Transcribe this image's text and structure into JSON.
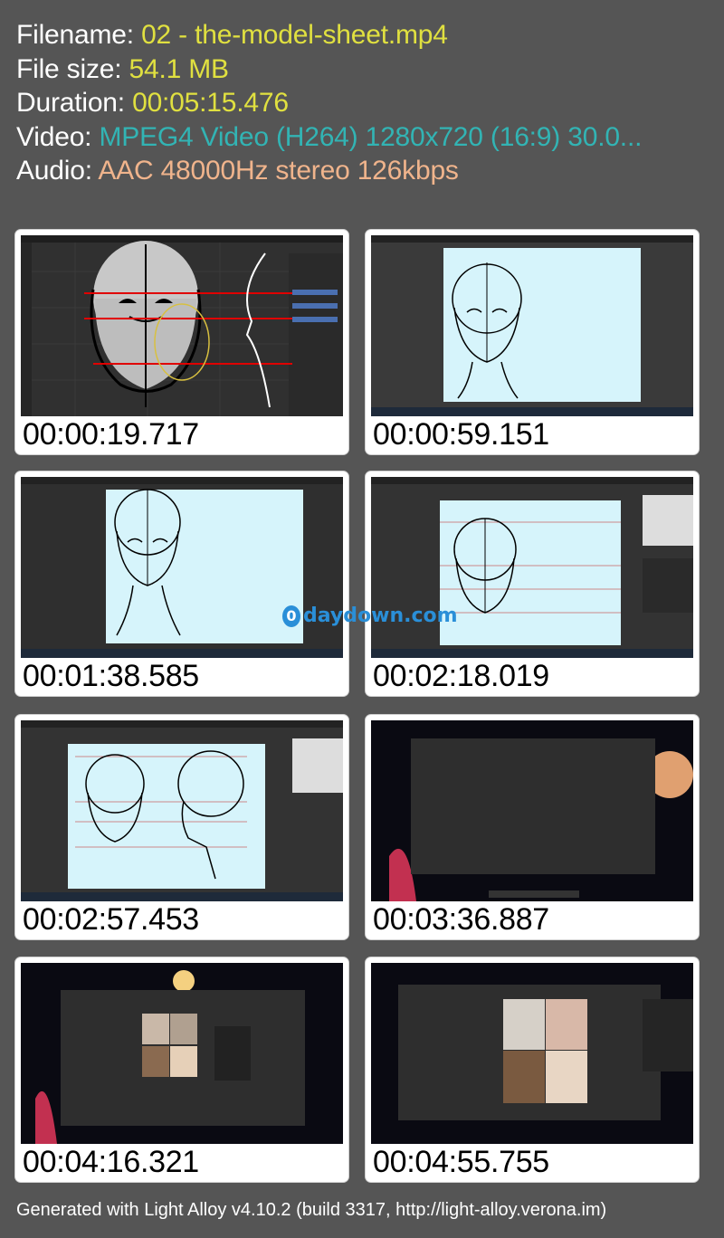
{
  "info": {
    "filename_label": "Filename: ",
    "filename_value": "02 - the-model-sheet.mp4",
    "filesize_label": "File size: ",
    "filesize_value": "54.1 MB",
    "duration_label": "Duration: ",
    "duration_value": "00:05:15.476",
    "video_label": "Video: ",
    "video_value": "MPEG4 Video (H264) 1280x720 (16:9) 30.0...",
    "audio_label": "Audio: ",
    "audio_value": "AAC 48000Hz stereo 126kbps"
  },
  "thumbnails": [
    {
      "timestamp": "00:00:19.717"
    },
    {
      "timestamp": "00:00:59.151"
    },
    {
      "timestamp": "00:01:38.585"
    },
    {
      "timestamp": "00:02:18.019"
    },
    {
      "timestamp": "00:02:57.453"
    },
    {
      "timestamp": "00:03:36.887"
    },
    {
      "timestamp": "00:04:16.321"
    },
    {
      "timestamp": "00:04:55.755"
    }
  ],
  "watermark": {
    "icon_glyph": "0",
    "text": "daydown.com"
  },
  "footer": "Generated with Light Alloy v4.10.2 (build 3317, http://light-alloy.verona.im)"
}
